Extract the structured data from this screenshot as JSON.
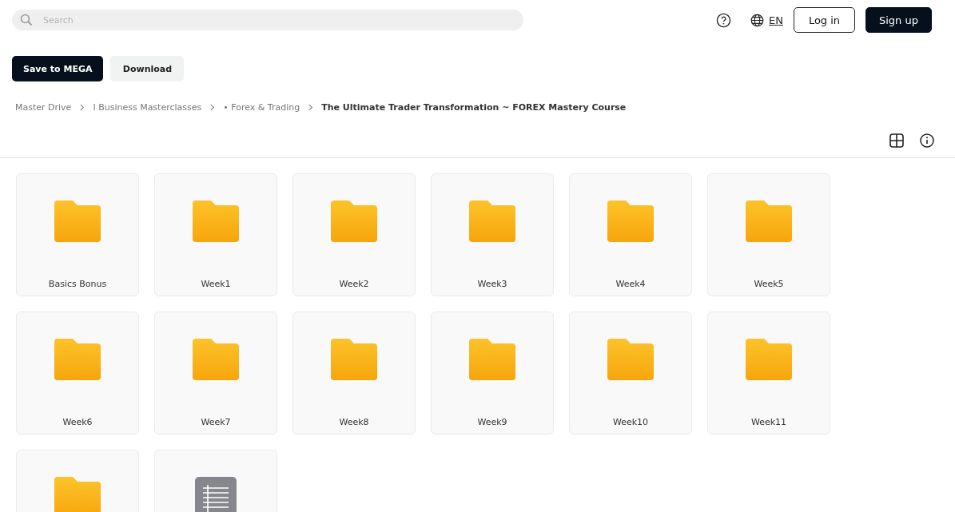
{
  "search": {
    "placeholder": "Search"
  },
  "header": {
    "language": "EN",
    "buttons": [
      "Log in",
      "Sign up"
    ]
  },
  "actions": [
    "Save to MEGA",
    "Download"
  ],
  "breadcrumb": [
    "Master Drive",
    "I Business Masterclasses",
    "• Forex & Trading",
    "The Ultimate Trader Transformation ~ FOREX Mastery Course"
  ],
  "items": [
    {
      "kind": "folder",
      "name": "Basics Bonus"
    },
    {
      "kind": "folder",
      "name": "Week1"
    },
    {
      "kind": "folder",
      "name": "Week2"
    },
    {
      "kind": "folder",
      "name": "Week3"
    },
    {
      "kind": "folder",
      "name": "Week4"
    },
    {
      "kind": "folder",
      "name": "Week5"
    },
    {
      "kind": "folder",
      "name": "Week6"
    },
    {
      "kind": "folder",
      "name": "Week7"
    },
    {
      "kind": "folder",
      "name": "Week8"
    },
    {
      "kind": "folder",
      "name": "Week9"
    },
    {
      "kind": "folder",
      "name": "Week10"
    },
    {
      "kind": "folder",
      "name": "Week11"
    },
    {
      "kind": "folder"
    },
    {
      "kind": "document"
    }
  ]
}
